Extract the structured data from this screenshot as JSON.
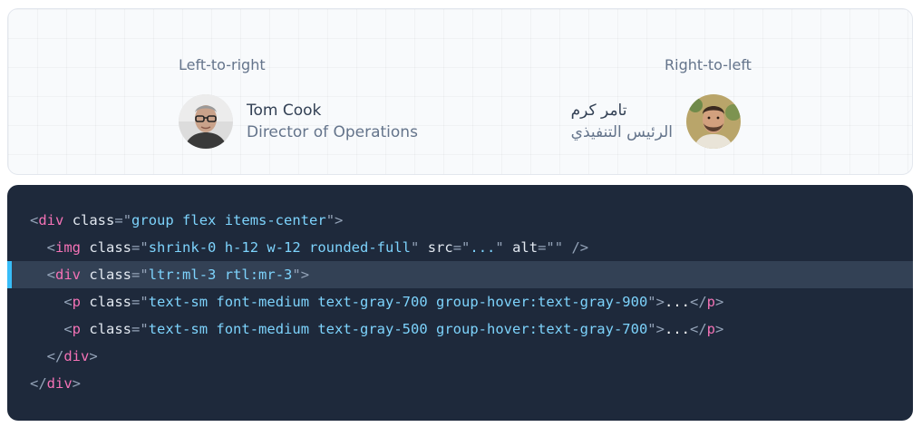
{
  "preview": {
    "ltr": {
      "heading": "Left-to-right",
      "name": "Tom Cook",
      "role": "Director of Operations",
      "avatar_icon": "person-photo-icon"
    },
    "rtl": {
      "heading": "Right-to-left",
      "name": "تامر كرم",
      "role": "الرئيس التنفيذي",
      "avatar_icon": "person-photo-icon"
    }
  },
  "code": {
    "highlight_color": "#38bdf8",
    "lines": [
      {
        "indent": "",
        "open": "<",
        "tag": "div",
        "attrs": [
          {
            "name": "class",
            "value": "group flex items-center"
          }
        ],
        "close": ">",
        "tail": "",
        "endtag": ""
      },
      {
        "indent": "  ",
        "open": "<",
        "tag": "img",
        "attrs": [
          {
            "name": "class",
            "value": "shrink-0 h-12 w-12 rounded-full"
          },
          {
            "name": "src",
            "value": "..."
          },
          {
            "name": "alt",
            "value": ""
          }
        ],
        "close": " />",
        "tail": "",
        "endtag": ""
      },
      {
        "indent": "  ",
        "open": "<",
        "tag": "div",
        "attrs": [
          {
            "name": "class",
            "value": "ltr:ml-3 rtl:mr-3"
          }
        ],
        "close": ">",
        "tail": "",
        "endtag": ""
      },
      {
        "indent": "    ",
        "open": "<",
        "tag": "p",
        "attrs": [
          {
            "name": "class",
            "value": "text-sm font-medium text-gray-700 group-hover:text-gray-900"
          }
        ],
        "close": ">",
        "tail": "...",
        "endtag": "p"
      },
      {
        "indent": "    ",
        "open": "<",
        "tag": "p",
        "attrs": [
          {
            "name": "class",
            "value": "text-sm font-medium text-gray-500 group-hover:text-gray-700"
          }
        ],
        "close": ">",
        "tail": "...",
        "endtag": "p"
      },
      {
        "indent": "  ",
        "open": "</",
        "tag": "div",
        "attrs": [],
        "close": ">",
        "tail": "",
        "endtag": ""
      },
      {
        "indent": "",
        "open": "</",
        "tag": "div",
        "attrs": [],
        "close": ">",
        "tail": "",
        "endtag": ""
      }
    ],
    "highlighted_line": 3
  }
}
